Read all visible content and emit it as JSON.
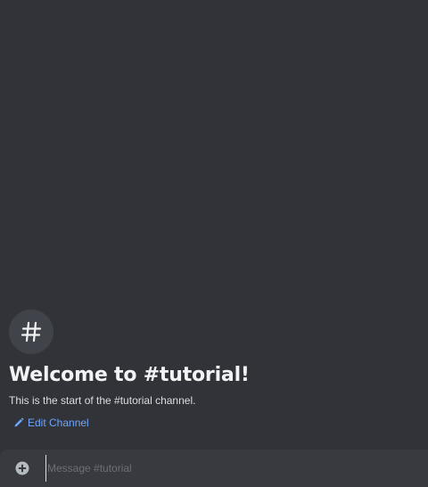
{
  "channel": {
    "name": "tutorial",
    "avatar_symbol": "#",
    "welcome_title": "Welcome to #tutorial!",
    "welcome_subtitle": "This is the start of the #tutorial channel.",
    "edit_label": "Edit Channel"
  },
  "composer": {
    "placeholder": "Message #tutorial",
    "value": "",
    "attach_icon": "plus-circle-icon"
  },
  "colors": {
    "background": "#313338",
    "composer_background": "#383a40",
    "avatar_background": "#41434a",
    "link": "#6ea6ff",
    "text": "#f2f3f5"
  }
}
